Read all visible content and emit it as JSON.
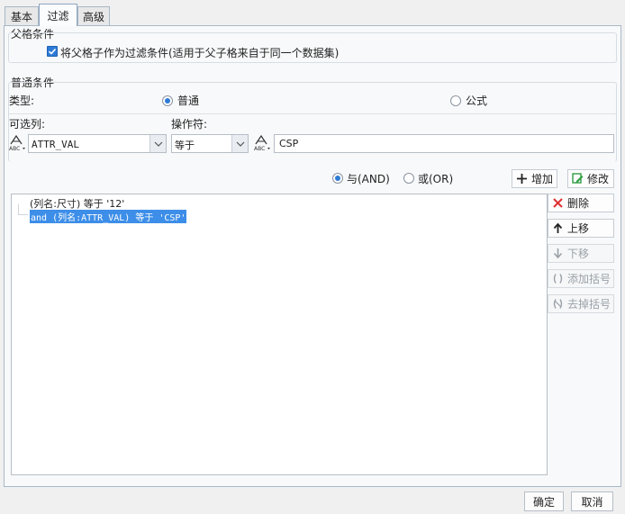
{
  "tabs": [
    {
      "label": "基本"
    },
    {
      "label": "过滤"
    },
    {
      "label": "高级"
    }
  ],
  "parent_condition": {
    "title": "父格条件",
    "checkbox_label": "将父格子作为过滤条件(适用于父子格来自于同一个数据集)",
    "checked": true
  },
  "normal_condition": {
    "title": "普通条件",
    "type_label": "类型:",
    "type_options": [
      {
        "label": "普通",
        "selected": true
      },
      {
        "label": "公式",
        "selected": false
      }
    ],
    "column_label": "可选列:",
    "operator_label": "操作符:",
    "column_value": "ATTR_VAL",
    "operator_value": "等于",
    "value_input": "CSP"
  },
  "join": {
    "and_label": "与(AND)",
    "or_label": "或(OR)",
    "and_selected": true
  },
  "actions": {
    "add": "增加",
    "modify": "修改",
    "delete": "删除",
    "move_up": "上移",
    "move_down": "下移",
    "add_bracket": "添加括号",
    "remove_bracket": "去掉括号"
  },
  "conditions": [
    {
      "text": "(列名:尺寸) 等于 '12'",
      "selected": false
    },
    {
      "text": "and (列名:ATTR_VAL) 等于 'CSP'",
      "selected": true
    }
  ],
  "footer": {
    "ok": "确定",
    "cancel": "取消"
  },
  "colors": {
    "accent": "#2e7bd6",
    "selection": "#3d8ee8",
    "delete_icon": "#e03030",
    "modify_icon": "#2f9e44"
  }
}
